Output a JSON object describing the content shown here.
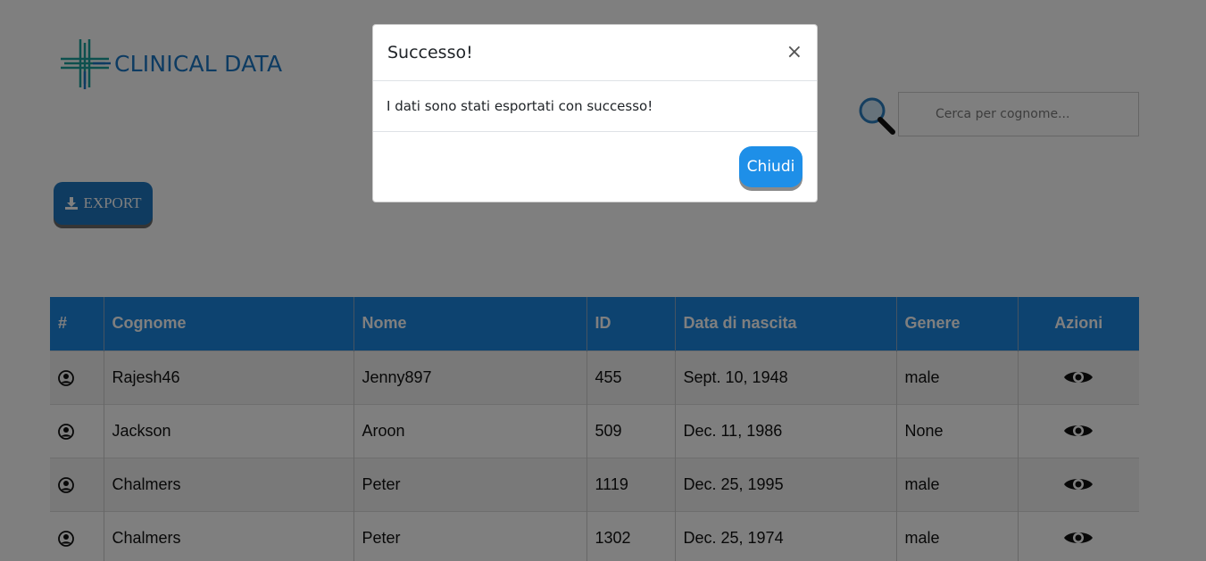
{
  "brand": {
    "logo_text": "CLINICAL DATA",
    "accent": "#1a76c4"
  },
  "toolbar": {
    "export_label": "EXPORT",
    "export_icon": "download-icon"
  },
  "search": {
    "placeholder": "Cerca per cognome...",
    "value": ""
  },
  "table": {
    "headers": [
      "#",
      "Cognome",
      "Nome",
      "ID",
      "Data di nascita",
      "Genere",
      "Azioni"
    ],
    "rows": [
      {
        "cognome": "Rajesh46",
        "nome": "Jenny897",
        "id": "455",
        "data": "Sept. 10, 1948",
        "genere": "male"
      },
      {
        "cognome": "Jackson",
        "nome": "Aroon",
        "id": "509",
        "data": "Dec. 11, 1986",
        "genere": "None"
      },
      {
        "cognome": "Chalmers",
        "nome": "Peter",
        "id": "1119",
        "data": "Dec. 25, 1995",
        "genere": "male"
      },
      {
        "cognome": "Chalmers",
        "nome": "Peter",
        "id": "1302",
        "data": "Dec. 25, 1974",
        "genere": "male"
      }
    ],
    "row_icon": "user-circle-icon",
    "action_icon": "eye-icon"
  },
  "modal": {
    "title": "Successo!",
    "close_symbol": "×",
    "message": "I dati sono stati esportati con successo!",
    "button_label": "Chiudi"
  },
  "colors": {
    "header_bg": "#1a86e0",
    "button_bg": "#1f76c0",
    "modal_button_bg": "#1e8fe8"
  }
}
